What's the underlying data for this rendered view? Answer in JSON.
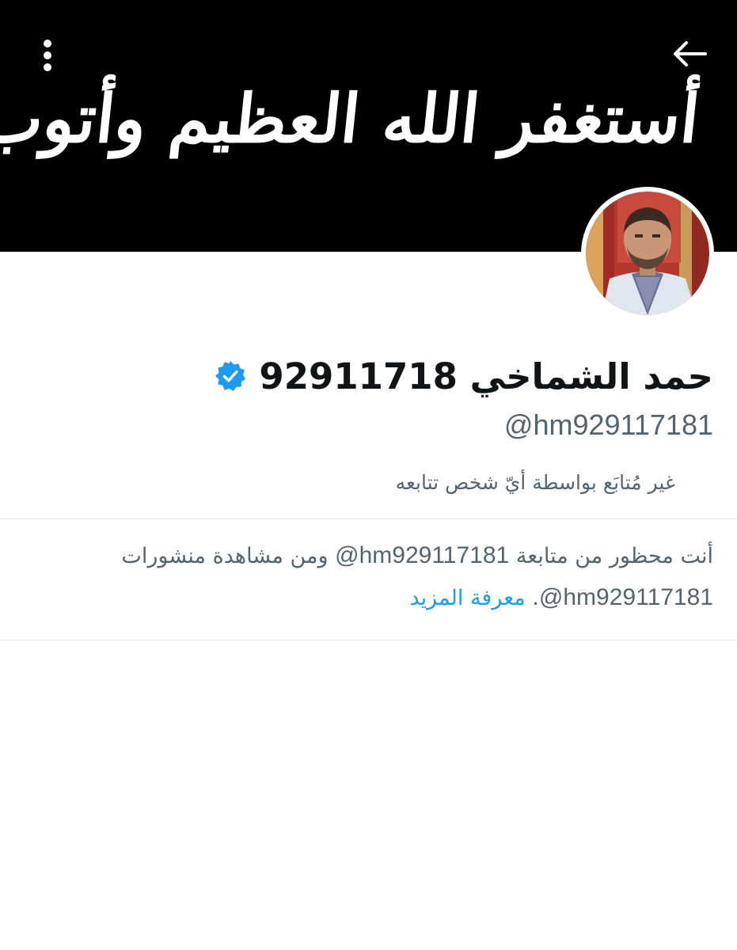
{
  "header": {
    "banner_text": "أستغفر الله العظيم وأتوب إليه",
    "back_icon": "arrow-left-icon",
    "more_icon": "more-vertical-icon",
    "banner_color": "#000000"
  },
  "profile": {
    "display_name": "حمد الشماخي 92911718",
    "verified_icon": "verified-badge-icon",
    "handle": "@hm929117181",
    "followed_by_text": "غير مُتابَع بواسطة أيّ شخص تتابعه"
  },
  "blocked_notice": {
    "line1_prefix": "أنت محظور من متابعة ",
    "handle": "@hm929117181",
    "line1_suffix": " ومن مشاهدة منشورات",
    "handle2": "@hm929117181",
    "period": ".",
    "learn_more": "معرفة المزيد"
  },
  "colors": {
    "text_primary": "#0f1419",
    "text_secondary": "#536471",
    "accent": "#1d9bf0",
    "divider": "#e1e6ea"
  }
}
